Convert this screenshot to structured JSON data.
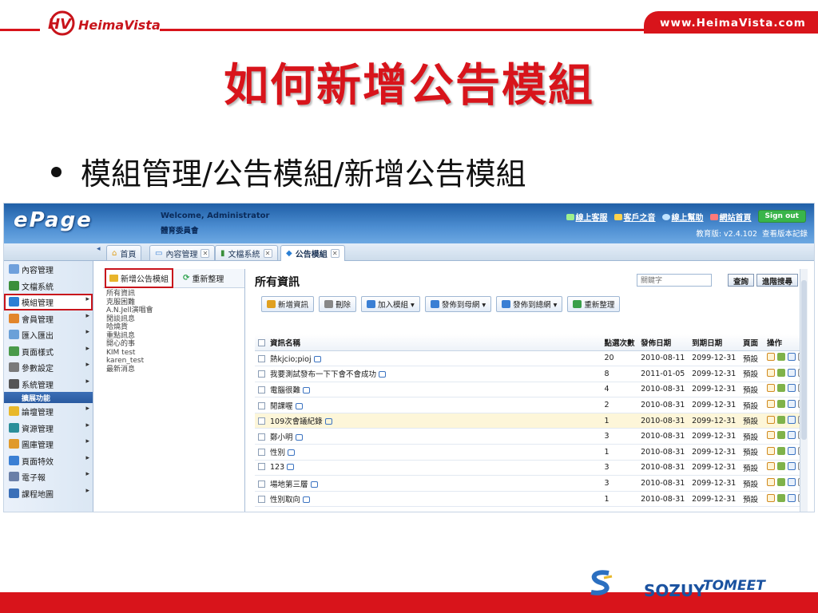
{
  "slide": {
    "logo_text": "HeimaVista",
    "url": "www.HeimaVista.com",
    "title": "如何新增公告模組",
    "bullet": "模組管理/公告模組/新增公告模組",
    "partners": [
      "SOZUY",
      "TOMEET"
    ]
  },
  "app": {
    "brand": "ePage",
    "welcome": "Welcome, Administrator",
    "org": "體育委員會",
    "top_links": [
      "線上客服",
      "客戶之音",
      "線上幫助",
      "網站首頁"
    ],
    "signout": "Sign out",
    "version": "教育版: v2.4.102",
    "version_link": "查看版本記錄",
    "tabs": [
      {
        "label": "首頁",
        "closable": false
      },
      {
        "label": "內容管理",
        "closable": true
      },
      {
        "label": "文檔系統",
        "closable": true
      },
      {
        "label": "公告模組",
        "closable": true,
        "active": true
      }
    ]
  },
  "leftnav": [
    {
      "label": "內容管理",
      "icon_color": "#6fa0dc",
      "arrow": false
    },
    {
      "label": "文檔系統",
      "icon_color": "#3a8f3a",
      "arrow": false
    },
    {
      "label": "模組管理",
      "icon_color": "#2a7fd4",
      "arrow": true,
      "selected": true
    },
    {
      "label": "會員管理",
      "icon_color": "#e2862b",
      "arrow": true
    },
    {
      "label": "匯入匯出",
      "icon_color": "#6aa0d8",
      "arrow": true
    },
    {
      "label": "頁面樣式",
      "icon_color": "#4a9a4a",
      "arrow": true
    },
    {
      "label": "參數設定",
      "icon_color": "#7a7a7a",
      "arrow": true
    },
    {
      "label": "系統管理",
      "icon_color": "#555",
      "arrow": true
    },
    {
      "label": "擴展功能",
      "bar": true
    },
    {
      "label": "論壇管理",
      "icon_color": "#e8b82b",
      "arrow": true
    },
    {
      "label": "資源管理",
      "icon_color": "#2b8f9a",
      "arrow": true
    },
    {
      "label": "圖庫管理",
      "icon_color": "#e09a2b",
      "arrow": true
    },
    {
      "label": "頁面特效",
      "icon_color": "#3a7fd4",
      "arrow": true
    },
    {
      "label": "電子報",
      "icon_color": "#6a7fa8",
      "arrow": true
    },
    {
      "label": "課程地圖",
      "icon_color": "#3a6fb8",
      "arrow": true
    }
  ],
  "midpanel": {
    "add_button": "新增公告模組",
    "refresh_button": "重新整理",
    "items": [
      "所有資訊",
      "克服困難",
      "A.N.Jell演唱會",
      "閒談訊息",
      "哈燒貨",
      "重點訊息",
      "開心的事",
      "KIM test",
      "karen_test",
      "最新消息"
    ]
  },
  "main": {
    "title": "所有資訊",
    "search_placeholder": "關鍵字",
    "query_button": "查詢",
    "advanced_button": "進階搜尋",
    "actions": [
      {
        "label": "新增資訊",
        "icon_color": "#e0a020"
      },
      {
        "label": "刪除",
        "icon_color": "#888"
      },
      {
        "label": "加入模組 ▾",
        "icon_color": "#3a7fd4"
      },
      {
        "label": "發佈到母網 ▾",
        "icon_color": "#3a7fd4"
      },
      {
        "label": "發佈到總網 ▾",
        "icon_color": "#3a7fd4"
      },
      {
        "label": "重新整理",
        "icon_color": "#3aa04a"
      }
    ],
    "columns": [
      "資訊名稱",
      "點選次數",
      "發佈日期",
      "到期日期",
      "頁面",
      "操作"
    ],
    "rows": [
      {
        "name": "熱kjcio;pioj",
        "clicks": "20",
        "publish": "2010-08-11",
        "expire": "2099-12-31",
        "page": "預設"
      },
      {
        "name": "我要測試發布一下下會不會成功",
        "clicks": "8",
        "publish": "2011-01-05",
        "expire": "2099-12-31",
        "page": "預設"
      },
      {
        "name": "電腦很難",
        "clicks": "4",
        "publish": "2010-08-31",
        "expire": "2099-12-31",
        "page": "預設"
      },
      {
        "name": "閒課喔",
        "clicks": "2",
        "publish": "2010-08-31",
        "expire": "2099-12-31",
        "page": "預設"
      },
      {
        "name": "109次會議紀錄",
        "clicks": "1",
        "publish": "2010-08-31",
        "expire": "2099-12-31",
        "page": "預設",
        "highlight": true
      },
      {
        "name": "鄭小明",
        "clicks": "3",
        "publish": "2010-08-31",
        "expire": "2099-12-31",
        "page": "預設"
      },
      {
        "name": "性別",
        "clicks": "1",
        "publish": "2010-08-31",
        "expire": "2099-12-31",
        "page": "預設"
      },
      {
        "name": "123",
        "clicks": "3",
        "publish": "2010-08-31",
        "expire": "2099-12-31",
        "page": "預設"
      },
      {
        "name": "場地第三層",
        "clicks": "3",
        "publish": "2010-08-31",
        "expire": "2099-12-31",
        "page": "預設"
      },
      {
        "name": "性別取向",
        "clicks": "1",
        "publish": "2010-08-31",
        "expire": "2099-12-31",
        "page": "預設"
      }
    ]
  }
}
